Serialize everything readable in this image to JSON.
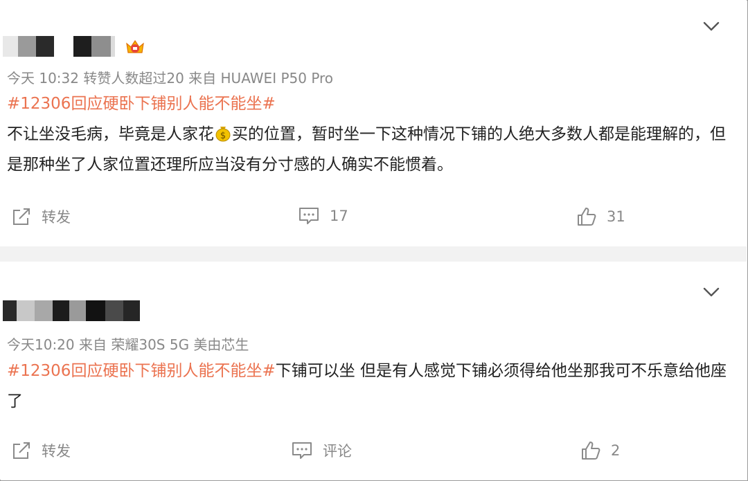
{
  "posts": [
    {
      "meta": "今天 10:32 转赞人数超过20  来自 HUAWEI P50 Pro",
      "topic": "#12306回应硬卧下铺别人能不能坐#",
      "text_before_emoji": "不让坐没毛病，毕竟是人家花",
      "emoji_icon": "money-bag-icon",
      "text_after_emoji": "买的位置，暂时坐一下这种情况下铺的人绝大多数人都是能理解的，但是那种坐了人家位置还理所应当没有分寸感的人确实不能惯着。",
      "actions": {
        "repost": "转发",
        "comment": "17",
        "like": "31"
      }
    },
    {
      "meta": "今天10:20  来自 荣耀30S 5G 美由芯生",
      "topic": "#12306回应硬卧下铺别人能不能坐#",
      "text": "下铺可以坐 但是有人感觉下铺必须得给他坐那我可不乐意给他座了",
      "actions": {
        "repost": "转发",
        "comment": "评论",
        "like": "2"
      }
    }
  ],
  "colors": {
    "topic": "#eb7350",
    "meta": "#888888",
    "text": "#222222",
    "separator": "#f2f2f2"
  }
}
